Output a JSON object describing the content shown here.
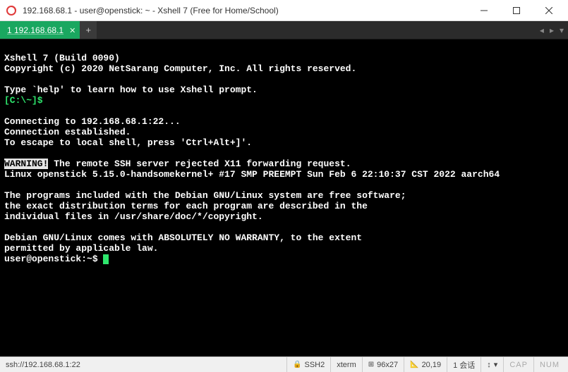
{
  "titlebar": {
    "title": "192.168.68.1 - user@openstick: ~ - Xshell 7 (Free for Home/School)"
  },
  "tabs": {
    "active": {
      "label": "1 192.168.68.1"
    }
  },
  "terminal": {
    "l1": "Xshell 7 (Build 0090)",
    "l2": "Copyright (c) 2020 NetSarang Computer, Inc. All rights reserved.",
    "l3": "Type `help' to learn how to use Xshell prompt.",
    "l4a": "[C:\\~]$",
    "l4b": " ",
    "l5": "Connecting to 192.168.68.1:22...",
    "l6": "Connection established.",
    "l7": "To escape to local shell, press 'Ctrl+Alt+]'.",
    "l8a": "WARNING!",
    "l8b": " The remote SSH server rejected X11 forwarding request.",
    "l9": "Linux openstick 5.15.0-handsomekernel+ #17 SMP PREEMPT Sun Feb 6 22:10:37 CST 2022 aarch64",
    "l10": "The programs included with the Debian GNU/Linux system are free software;",
    "l11": "the exact distribution terms for each program are described in the",
    "l12": "individual files in /usr/share/doc/*/copyright.",
    "l13": "Debian GNU/Linux comes with ABSOLUTELY NO WARRANTY, to the extent",
    "l14": "permitted by applicable law.",
    "l15": "user@openstick:~$ "
  },
  "status": {
    "path": "ssh://192.168.68.1:22",
    "proto": "SSH2",
    "term": "xterm",
    "size": "96x27",
    "cursor": "20,19",
    "sessions": "1 会话",
    "caplock": "CAP",
    "numlock": "NUM"
  }
}
